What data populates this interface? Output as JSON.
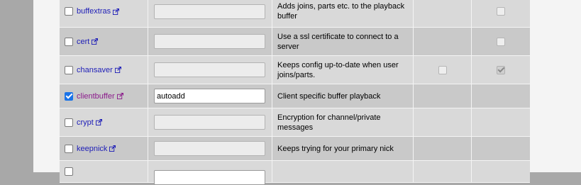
{
  "modules": [
    {
      "name": "buffextras",
      "checked": false,
      "args": "",
      "args_enabled": false,
      "description": "Adds joins, parts etc. to the playback buffer",
      "user_cb": null,
      "global_cb": {
        "checked": false
      }
    },
    {
      "name": "cert",
      "checked": false,
      "args": "",
      "args_enabled": false,
      "description": "Use a ssl certificate to connect to a server",
      "user_cb": null,
      "global_cb": {
        "checked": false
      }
    },
    {
      "name": "chansaver",
      "checked": false,
      "args": "",
      "args_enabled": false,
      "description": "Keeps config up-to-date when user joins/parts.",
      "user_cb": {
        "checked": false
      },
      "global_cb": {
        "checked": true
      }
    },
    {
      "name": "clientbuffer",
      "checked": true,
      "args": "autoadd",
      "args_enabled": true,
      "description": "Client specific buffer playback",
      "user_cb": null,
      "global_cb": null
    },
    {
      "name": "crypt",
      "checked": false,
      "args": "",
      "args_enabled": false,
      "description": "Encryption for channel/private messages",
      "user_cb": null,
      "global_cb": null
    },
    {
      "name": "keepnick",
      "checked": false,
      "args": "",
      "args_enabled": false,
      "description": "Keeps trying for your primary nick",
      "user_cb": null,
      "global_cb": null
    },
    {
      "name": "",
      "checked": false,
      "args": "",
      "args_enabled": true,
      "description": "",
      "user_cb": null,
      "global_cb": null
    }
  ],
  "icons": {
    "external_link": "external-link-icon"
  },
  "colors": {
    "link": "#1d1db7",
    "loaded_link": "#8b1a8b",
    "checkbox_checked": "#1a73e8"
  }
}
